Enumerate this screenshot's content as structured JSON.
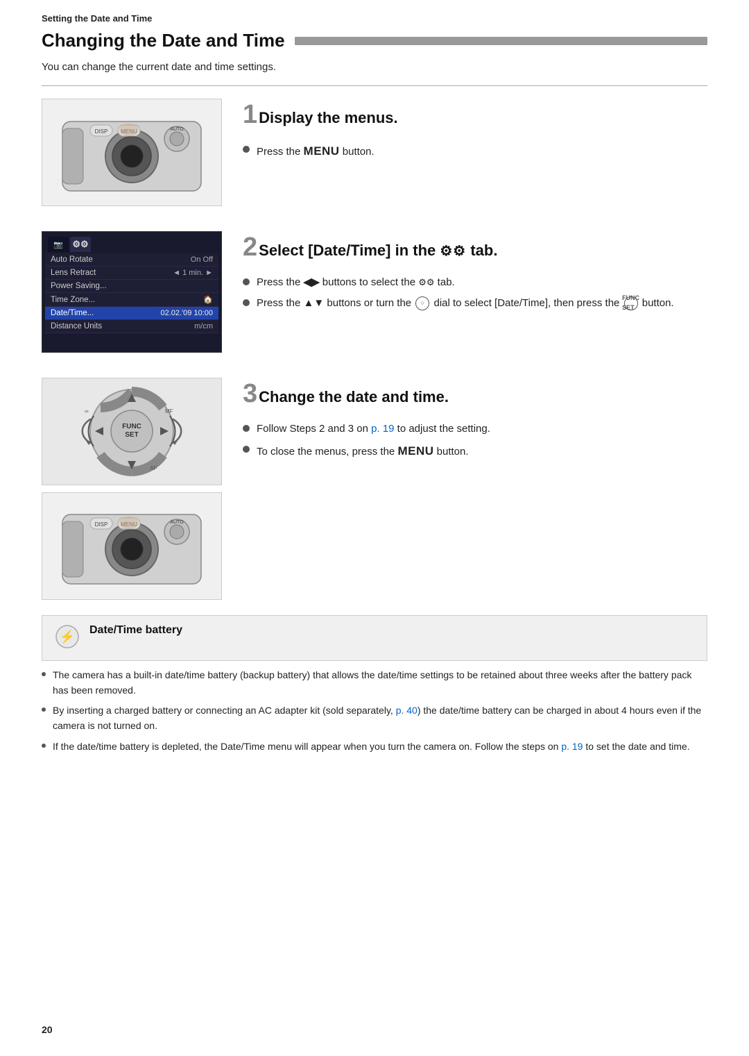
{
  "header": {
    "text": "Setting the Date and Time"
  },
  "page": {
    "title": "Changing the Date and Time",
    "intro": "You can change the current date and time settings.",
    "page_number": "20"
  },
  "steps": [
    {
      "number": "1",
      "heading": "Display the menus.",
      "bullets": [
        {
          "text_parts": [
            "Press the ",
            "MENU",
            " button."
          ]
        }
      ]
    },
    {
      "number": "2",
      "heading": "Select [Date/Time] in the",
      "heading_icon": "⚙⚙",
      "heading_suffix": " tab.",
      "bullets": [
        {
          "text_parts": [
            "Press the ",
            "◀▶",
            " buttons to select the ",
            "⚙⚙",
            " tab."
          ]
        },
        {
          "text_parts": [
            "Press the ",
            "▲▼",
            " buttons or turn the ",
            "○",
            " dial to select [Date/Time], then press the ",
            "FUNC",
            " button."
          ]
        }
      ]
    },
    {
      "number": "3",
      "heading": "Change the date and time.",
      "bullets": [
        {
          "text_parts": [
            "Follow Steps 2 and 3 on ",
            "p. 19",
            " to adjust the setting."
          ]
        },
        {
          "text_parts": [
            "To close the menus, press the ",
            "MENU",
            " button."
          ]
        }
      ]
    }
  ],
  "menu_screen": {
    "tabs": [
      {
        "label": "📷",
        "active": false
      },
      {
        "label": "⚙⚙",
        "active": true
      }
    ],
    "items": [
      {
        "label": "Auto Rotate",
        "value": "On  Off",
        "highlighted": false
      },
      {
        "label": "Lens Retract",
        "value": "◄ 1 min.",
        "arrow": true,
        "highlighted": false
      },
      {
        "label": "Power Saving...",
        "value": "",
        "highlighted": false
      },
      {
        "label": "Time Zone...",
        "value": "🏠",
        "highlighted": false
      },
      {
        "label": "Date/Time...",
        "value": "02.02.'09 10:00",
        "highlighted": true
      },
      {
        "label": "Distance Units",
        "value": "m/cm",
        "highlighted": false
      }
    ]
  },
  "note_box": {
    "icon": "⚡",
    "title": "Date/Time battery"
  },
  "note_bullets": [
    "The camera has a built-in date/time battery (backup battery) that allows the date/time settings to be retained about three weeks after the battery pack has been removed.",
    "By inserting a charged battery or connecting an AC adapter kit (sold separately, p. 40) the date/time battery can be charged in about 4 hours even if the camera is not turned on.",
    "If the date/time battery is depleted, the Date/Time menu will appear when you turn the camera on. Follow the steps on p. 19 to set the date and time."
  ],
  "links": {
    "p19_1": "p. 19",
    "p40": "p. 40",
    "p19_2": "p. 19"
  }
}
